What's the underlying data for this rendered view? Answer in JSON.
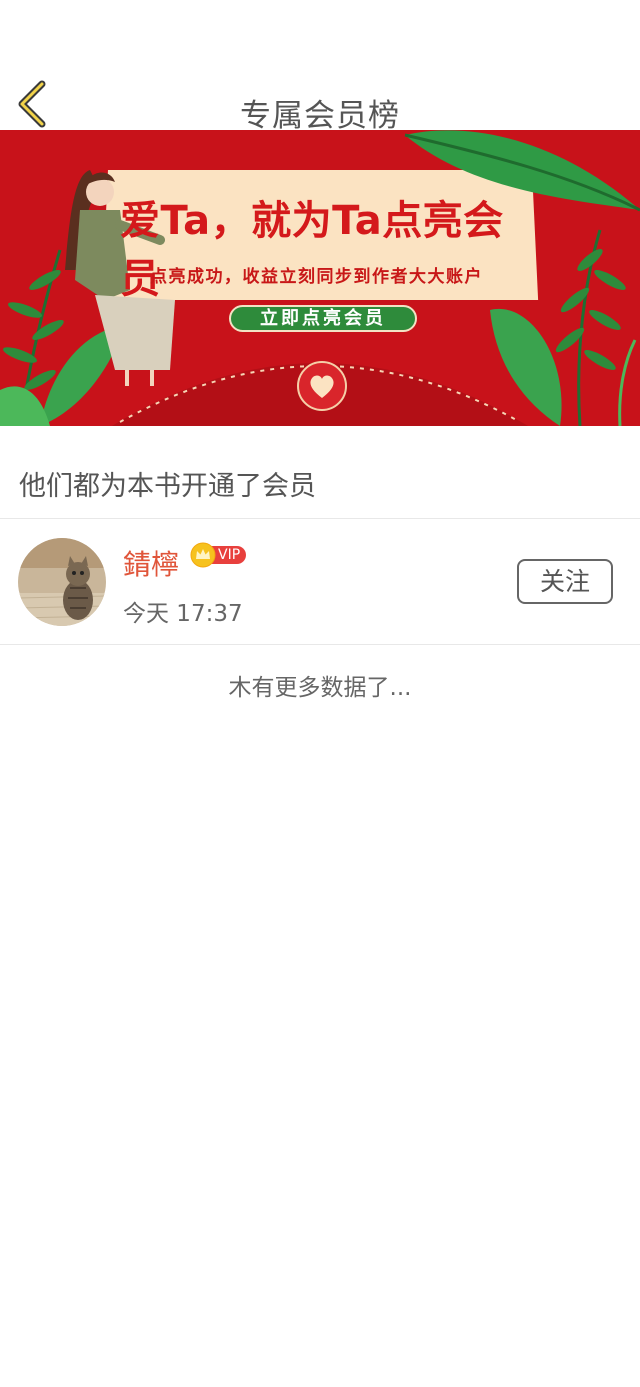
{
  "header": {
    "title": "专属会员榜"
  },
  "banner": {
    "title": "爱Ta，就为Ta点亮会员",
    "subtitle": "点亮成功，收益立刻同步到作者大大账户",
    "cta": "立即点亮会员"
  },
  "section": {
    "heading": "他们都为本书开通了会员"
  },
  "members": [
    {
      "name": "錆檸",
      "badge": "VIP",
      "time": "今天 17:37",
      "follow_label": "关注"
    }
  ],
  "footer": {
    "no_more": "木有更多数据了..."
  },
  "colors": {
    "accent": "#e0553a",
    "banner_red": "#c8121a",
    "banner_cream": "#fbe3c2",
    "leaf_green": "#2e8b3b"
  }
}
